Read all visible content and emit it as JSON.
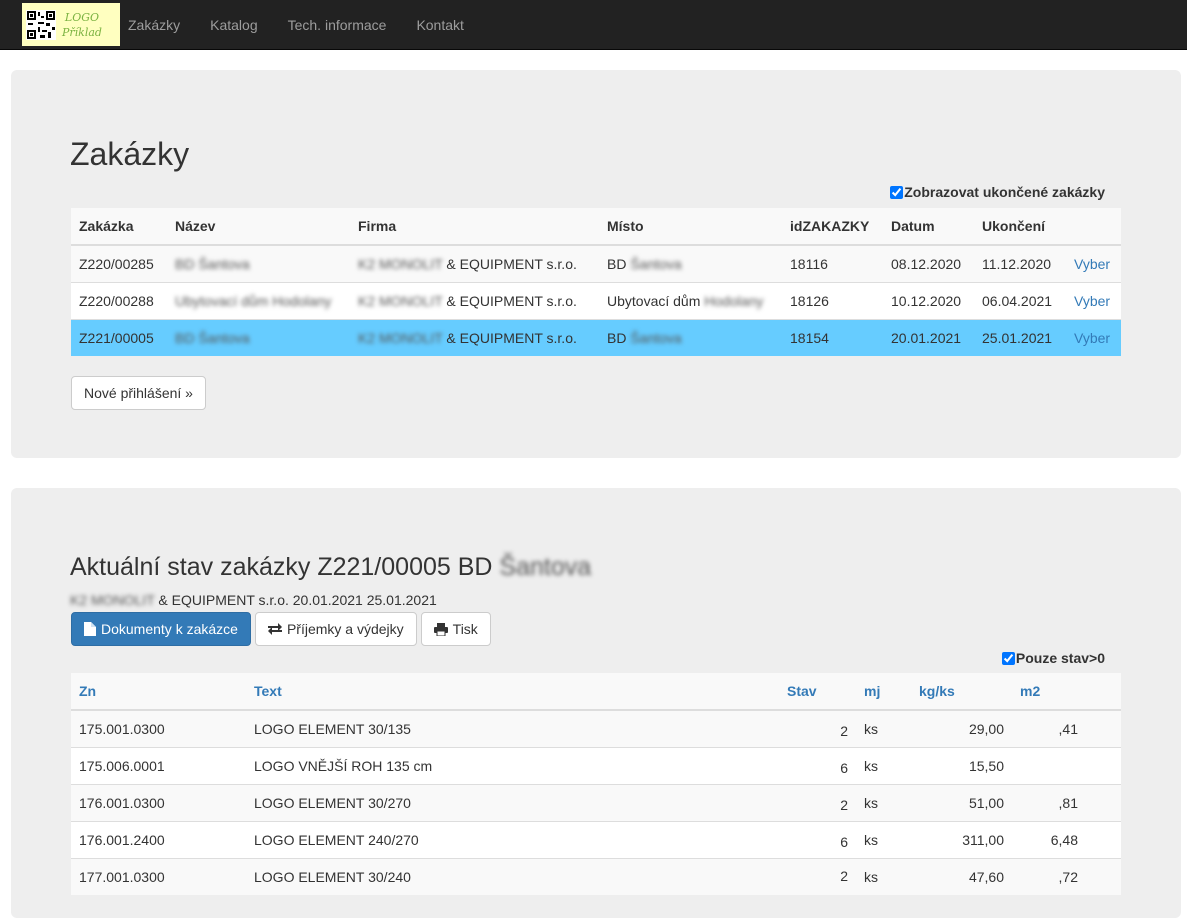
{
  "nav": {
    "logo_line1": "LOGO",
    "logo_line2": "Příklad",
    "items": [
      "Zakázky",
      "Katalog",
      "Tech. informace",
      "Kontakt"
    ]
  },
  "orders": {
    "title": "Zakázky",
    "show_finished_label": "Zobrazovat ukončené zakázky",
    "show_finished_checked": true,
    "columns": [
      "Zakázka",
      "Název",
      "Firma",
      "Místo",
      "idZAKAZKY",
      "Datum",
      "Ukončení",
      ""
    ],
    "rows": [
      {
        "zakazka": "Z220/00285",
        "nazev": "BD Šantova",
        "firma_a": "K2 MONOLIT",
        "firma_b": " & EQUIPMENT s.r.o.",
        "misto_a": "BD ",
        "misto_b": "Šantova",
        "id": "18116",
        "datum": "08.12.2020",
        "ukonceni": "11.12.2020",
        "action": "Vyber"
      },
      {
        "zakazka": "Z220/00288",
        "nazev": "Ubytovací dům Hodolany",
        "firma_a": "K2 MONOLIT",
        "firma_b": " & EQUIPMENT s.r.o.",
        "misto_a": "Ubytovací dům ",
        "misto_b": "Hodolany",
        "id": "18126",
        "datum": "10.12.2020",
        "ukonceni": "06.04.2021",
        "action": "Vyber"
      },
      {
        "zakazka": "Z221/00005",
        "nazev": "BD Šantova",
        "firma_a": "K2 MONOLIT",
        "firma_b": " & EQUIPMENT s.r.o.",
        "misto_a": "BD ",
        "misto_b": "Šantova",
        "id": "18154",
        "datum": "20.01.2021",
        "ukonceni": "25.01.2021",
        "action": "Vyber"
      }
    ],
    "selected_row": 2,
    "new_login_button": "Nové přihlášení »"
  },
  "status": {
    "title_prefix": "Aktuální stav zakázky Z221/00005 BD ",
    "title_blurred": "Šantova",
    "sub_blurred": "K2 MONOLIT",
    "sub_text": " & EQUIPMENT s.r.o. 20.01.2021 25.01.2021",
    "buttons": {
      "documents": "Dokumenty k zakázce",
      "receipts": "Příjemky a výdejky",
      "print": "Tisk"
    },
    "only_positive_label": "Pouze stav>0",
    "only_positive_checked": true,
    "columns": [
      "Zn",
      "Text",
      "Stav",
      "mj",
      "kg/ks",
      "m2"
    ],
    "rows": [
      {
        "zn": "175.001.0300",
        "text": "LOGO ELEMENT 30/135",
        "stav": "2",
        "mj": "ks",
        "kg": "29,00",
        "m2": ",41"
      },
      {
        "zn": "175.006.0001",
        "text": "LOGO VNĚJŠÍ ROH 135 cm",
        "stav": "6",
        "mj": "ks",
        "kg": "15,50",
        "m2": ""
      },
      {
        "zn": "176.001.0300",
        "text": "LOGO ELEMENT 30/270",
        "stav": "2",
        "mj": "ks",
        "kg": "51,00",
        "m2": ",81"
      },
      {
        "zn": "176.001.2400",
        "text": "LOGO ELEMENT 240/270",
        "stav": "6",
        "mj": "ks",
        "kg": "311,00",
        "m2": "6,48"
      },
      {
        "zn": "177.001.0300",
        "text": "LOGO ELEMENT 30/240",
        "stav": "2",
        "mj": "ks",
        "kg": "47,60",
        "m2": ",72"
      }
    ]
  }
}
